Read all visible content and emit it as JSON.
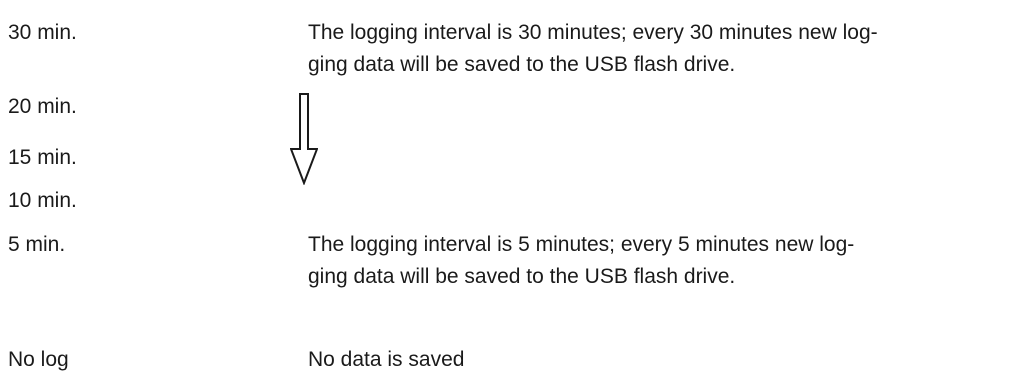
{
  "rows": [
    {
      "setting": "30 min.",
      "description_lines": [
        "The logging interval is 30 minutes; every 30 minutes new log-",
        "ging data will be saved to the USB flash drive."
      ]
    },
    {
      "setting": "20 min."
    },
    {
      "setting": "15 min."
    },
    {
      "setting": "10 min."
    },
    {
      "setting": "5 min.",
      "description_lines": [
        "The logging interval is 5 minutes; every 5 minutes new log-",
        "ging data will be saved to the USB flash drive."
      ]
    },
    {
      "setting": "No log",
      "description_lines": [
        "No data is saved"
      ]
    }
  ],
  "arrow": {
    "icon": "down-arrow-icon",
    "color": "#1a1a1a"
  }
}
